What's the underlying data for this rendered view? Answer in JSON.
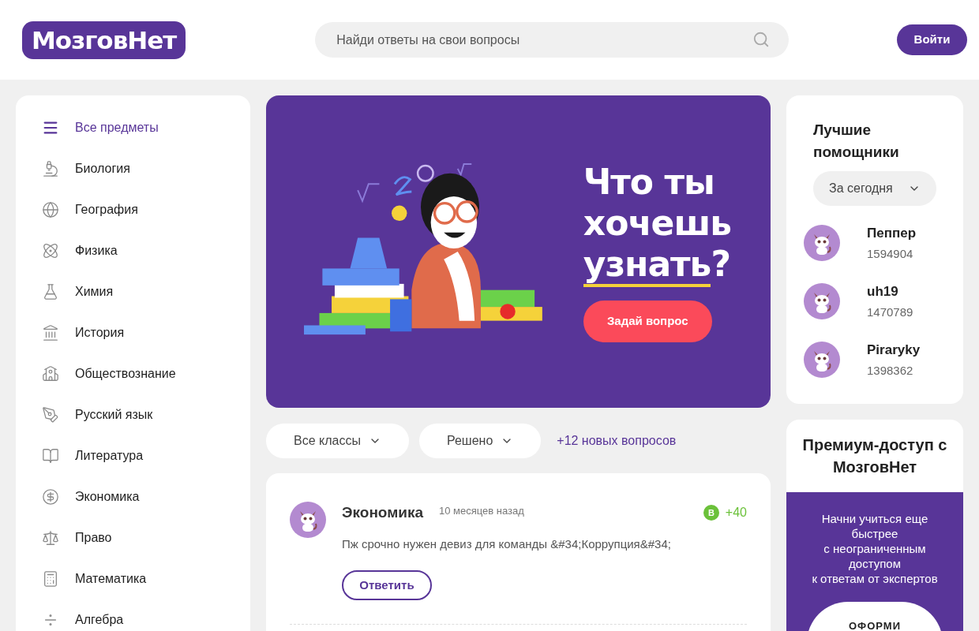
{
  "header": {
    "logo": "МозговНет",
    "search": {
      "placeholder": "Найди ответы на свои вопросы"
    },
    "login_button": "Войти"
  },
  "sidebar": {
    "items": [
      {
        "label": "Все предметы",
        "selected": true
      },
      {
        "label": "Биология",
        "selected": false
      },
      {
        "label": "География",
        "selected": false
      },
      {
        "label": "Физика",
        "selected": false
      },
      {
        "label": "Химия",
        "selected": false
      },
      {
        "label": "История",
        "selected": false
      },
      {
        "label": "Обществознание",
        "selected": false
      },
      {
        "label": "Русский язык",
        "selected": false
      },
      {
        "label": "Литература",
        "selected": false
      },
      {
        "label": "Экономика",
        "selected": false
      },
      {
        "label": "Право",
        "selected": false
      },
      {
        "label": "Математика",
        "selected": false
      },
      {
        "label": "Алгебра",
        "selected": false
      }
    ]
  },
  "hero": {
    "title_lines": [
      "Что ты",
      "хочешь"
    ],
    "underlined_word": "узнать",
    "title_end": "?",
    "button": "Задай вопрос"
  },
  "filters": {
    "dropdowns": [
      "Все классы",
      "Решено"
    ],
    "new_questions_link": "+12 новых вопросов"
  },
  "questions": [
    {
      "subject": "Экономика",
      "time": "10 месяцев назад",
      "points_letter": "B",
      "points": "+40",
      "text": "Пж срочно нужен девиз для команды &#34;Коррупция&#34;",
      "answer_button": "Ответить"
    }
  ],
  "helpers": {
    "title": "Лучшие помощники",
    "period": "За сегодня",
    "users": [
      {
        "name": "Пеппер",
        "score": "1594904"
      },
      {
        "name": "uh19",
        "score": "1470789"
      },
      {
        "name": "Piraryky",
        "score": "1398362"
      }
    ]
  },
  "premium": {
    "title": "Премиум-доступ с МозговНет",
    "text_lines": [
      "Начни учиться еще быстрее",
      "с неограниченным доступом",
      "к ответам от экспертов"
    ],
    "button": "ОФОРМИ"
  }
}
